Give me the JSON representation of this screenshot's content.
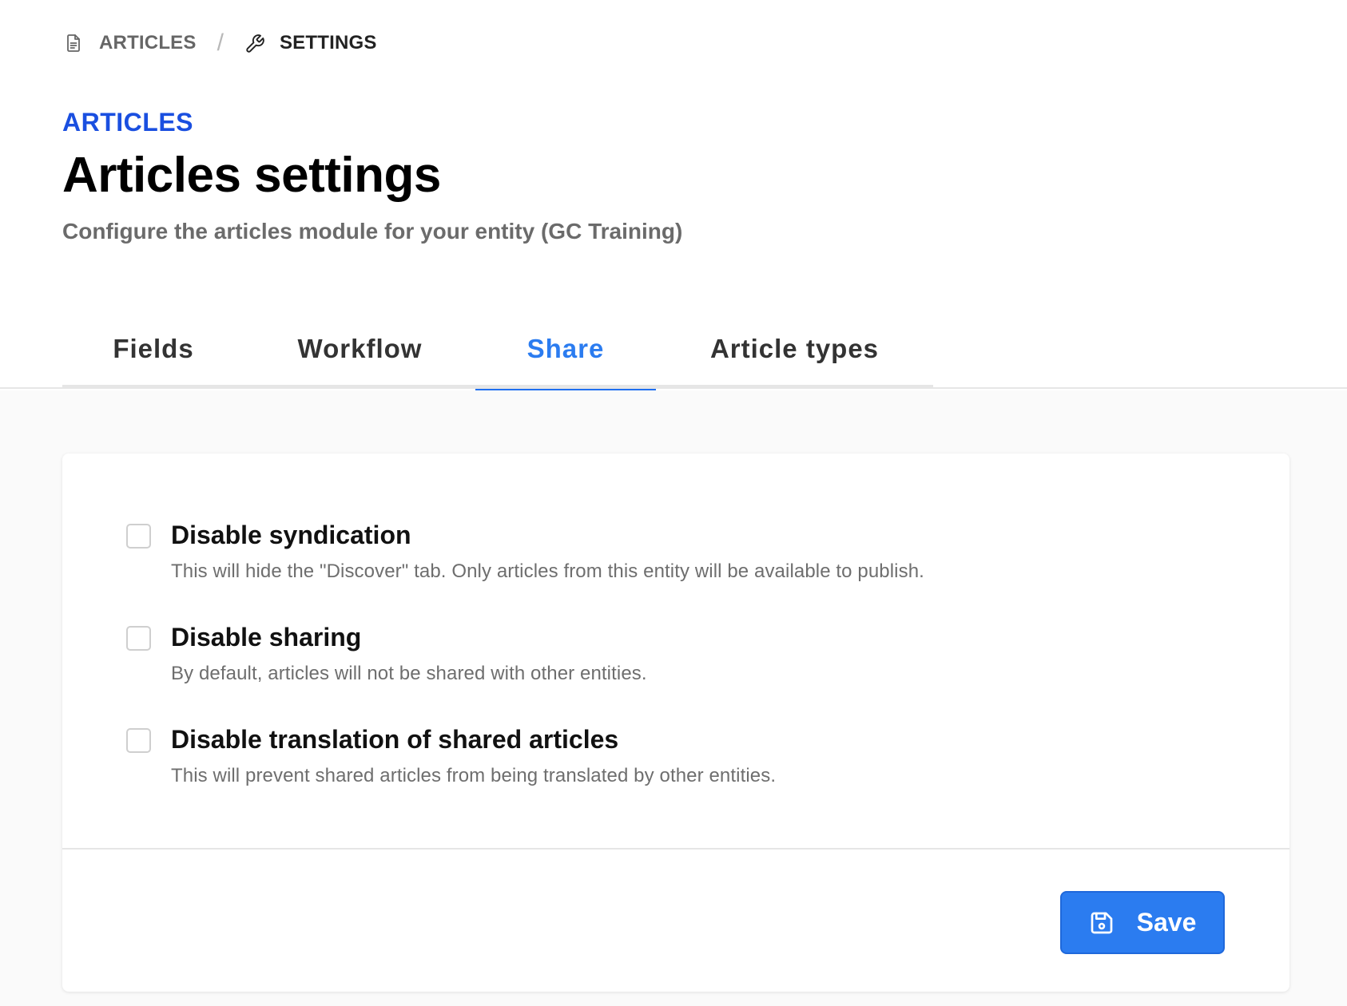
{
  "breadcrumb": {
    "items": [
      {
        "label": "ARTICLES",
        "icon": "document-icon"
      },
      {
        "label": "SETTINGS",
        "icon": "wrench-icon"
      }
    ],
    "separator": "/"
  },
  "header": {
    "eyebrow": "ARTICLES",
    "title": "Articles settings",
    "subtitle": "Configure the articles module for your entity (GC Training)"
  },
  "tabs": [
    {
      "label": "Fields",
      "active": false
    },
    {
      "label": "Workflow",
      "active": false
    },
    {
      "label": "Share",
      "active": true
    },
    {
      "label": "Article types",
      "active": false
    }
  ],
  "options": [
    {
      "label": "Disable syndication",
      "description": "This will hide the \"Discover\" tab. Only articles from this entity will be available to publish.",
      "checked": false
    },
    {
      "label": "Disable sharing",
      "description": "By default, articles will not be shared with other entities.",
      "checked": false
    },
    {
      "label": "Disable translation of shared articles",
      "description": "This will prevent shared articles from being translated by other entities.",
      "checked": false
    }
  ],
  "actions": {
    "save_label": "Save",
    "save_icon": "floppy-disk-icon"
  },
  "colors": {
    "accent": "#2b7cf0",
    "eyebrow": "#1a4fe0",
    "muted_text": "#6b6b6b",
    "content_background": "#fafafa"
  }
}
